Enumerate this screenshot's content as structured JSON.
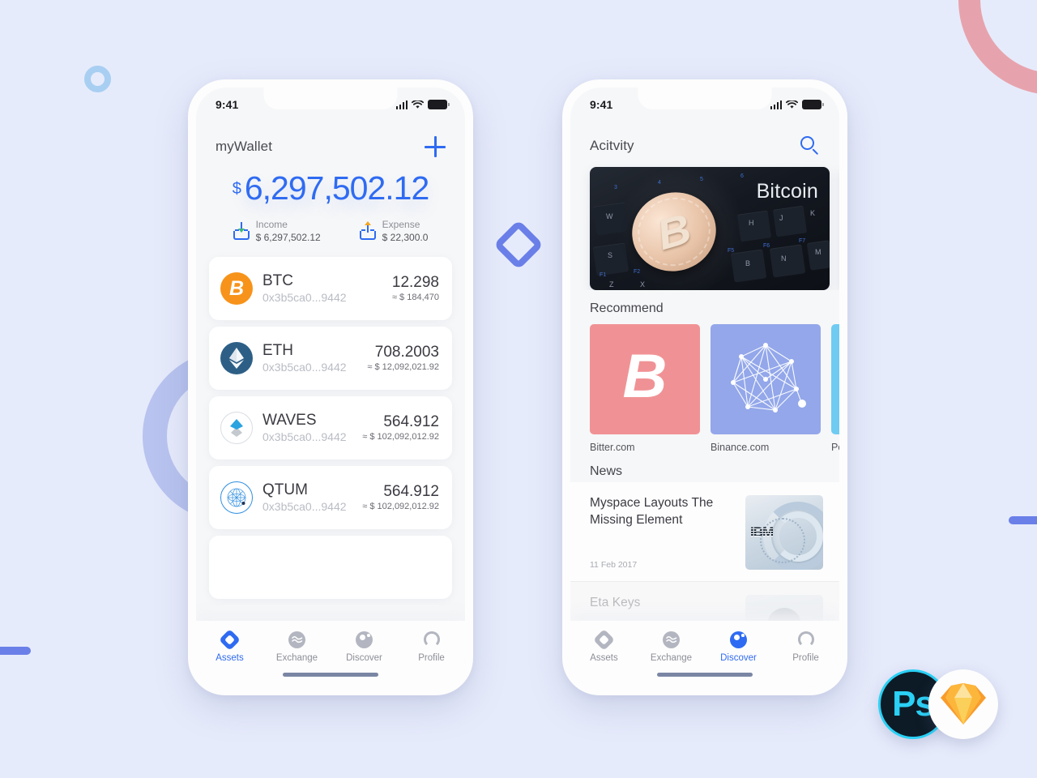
{
  "theme": {
    "background": "#e6ebfb",
    "accent": "#2f6bf2",
    "phone_body": "#fdfdfd",
    "screen_bg": "#f6f7f8",
    "muted_text": "#8e8e96"
  },
  "decor": {
    "ring_small_color": "#a8cff2",
    "ring_pink_color": "#e7a3ad",
    "ring_purple_color": "#b8c3ef",
    "bar_color": "#6a7fe8",
    "diamond_color": "#6a7fe8"
  },
  "status_bar": {
    "time": "9:41",
    "signal_icon": "cellular-signal-icon",
    "wifi_icon": "wifi-icon",
    "battery_icon": "battery-full-icon"
  },
  "wallet_screen": {
    "header": {
      "title": "myWallet",
      "add_icon": "plus-icon"
    },
    "balance": {
      "currency_symbol": "$",
      "amount": "6,297,502.12"
    },
    "flows": [
      {
        "label": "Income",
        "value": "$ 6,297,502.12",
        "icon": "income-download-icon",
        "arrow_color": "#3cb878"
      },
      {
        "label": "Expense",
        "value": "$ 22,300.0",
        "icon": "expense-upload-icon",
        "arrow_color": "#f5a623"
      }
    ],
    "assets": [
      {
        "symbol": "BTC",
        "address": "0x3b5ca0...9442",
        "quantity": "12.298",
        "fiat": "≈ $ 184,470",
        "icon": "bitcoin-coin-icon"
      },
      {
        "symbol": "ETH",
        "address": "0x3b5ca0...9442",
        "quantity": "708.2003",
        "fiat": "≈ $ 12,092,021.92",
        "icon": "ethereum-coin-icon"
      },
      {
        "symbol": "WAVES",
        "address": "0x3b5ca0...9442",
        "quantity": "564.912",
        "fiat": "≈ $ 102,092,012.92",
        "icon": "waves-coin-icon"
      },
      {
        "symbol": "QTUM",
        "address": "0x3b5ca0...9442",
        "quantity": "564.912",
        "fiat": "≈ $ 102,092,012.92",
        "icon": "qtum-coin-icon"
      }
    ],
    "tabs": [
      {
        "label": "Assets",
        "icon": "assets-diamond-icon",
        "active": true
      },
      {
        "label": "Exchange",
        "icon": "exchange-wave-icon",
        "active": false
      },
      {
        "label": "Discover",
        "icon": "discover-dot-icon",
        "active": false
      },
      {
        "label": "Profile",
        "icon": "profile-person-icon",
        "active": false
      }
    ]
  },
  "discover_screen": {
    "header": {
      "title": "Acitvity",
      "search_icon": "search-icon"
    },
    "banners": [
      {
        "caption": "Bitcoin",
        "style": "keyboard-coin"
      },
      {
        "caption": "",
        "style": "teal-abstract"
      }
    ],
    "recommend": {
      "section_title": "Recommend",
      "items": [
        {
          "label": "Bitter.com",
          "color": "#f09295",
          "icon": "bitcoin-b-icon"
        },
        {
          "label": "Binance.com",
          "color": "#93a7ea",
          "icon": "network-polygon-icon"
        },
        {
          "label": "Poloniex.com",
          "color": "#70cbf2",
          "icon": "poloniex-icon"
        }
      ]
    },
    "news": {
      "section_title": "News",
      "items": [
        {
          "title": "Myspace Layouts The Missing Element",
          "date": "11 Feb 2017",
          "thumb": "ibm-server-thumb"
        },
        {
          "title": "Eta Keys",
          "date": "",
          "thumb": "person-thumb"
        }
      ]
    },
    "tabs": [
      {
        "label": "Assets",
        "icon": "assets-diamond-icon",
        "active": false
      },
      {
        "label": "Exchange",
        "icon": "exchange-wave-icon",
        "active": false
      },
      {
        "label": "Discover",
        "icon": "discover-dot-icon",
        "active": true
      },
      {
        "label": "Profile",
        "icon": "profile-person-icon",
        "active": false
      }
    ]
  },
  "app_logos": [
    {
      "name": "photoshop-logo",
      "text": "Ps"
    },
    {
      "name": "sketch-logo",
      "text": ""
    }
  ]
}
